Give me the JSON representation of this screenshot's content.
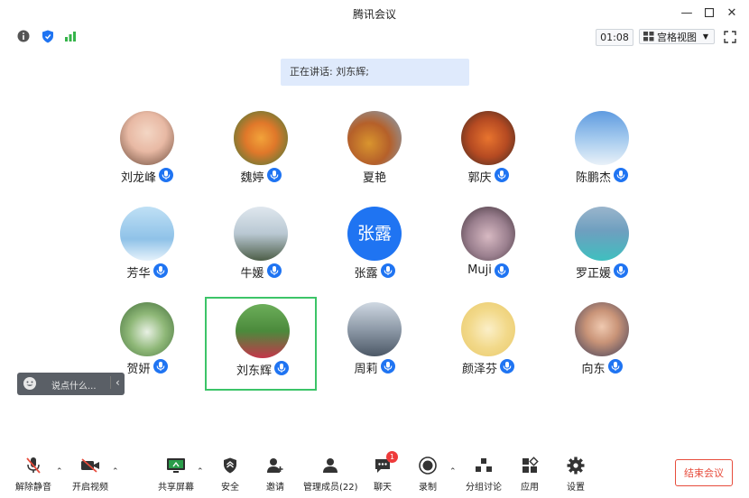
{
  "window": {
    "title": "腾讯会议"
  },
  "infobar": {
    "timer": "01:08",
    "view_mode": "宫格视图"
  },
  "speaking": {
    "text": "正在讲话: 刘东辉;"
  },
  "participants": [
    {
      "name": "刘龙峰",
      "mic": true
    },
    {
      "name": "魏婷",
      "mic": true
    },
    {
      "name": "夏艳",
      "mic": false
    },
    {
      "name": "郭庆",
      "mic": true
    },
    {
      "name": "陈鹏杰",
      "mic": true
    },
    {
      "name": "芳华",
      "mic": true
    },
    {
      "name": "牛媛",
      "mic": true
    },
    {
      "name": "张露",
      "mic": true,
      "avatar_text": "张露"
    },
    {
      "name": "Muji",
      "mic": true
    },
    {
      "name": "罗正媛",
      "mic": true
    },
    {
      "name": "贺妍",
      "mic": true
    },
    {
      "name": "刘东辉",
      "mic": true,
      "active": true
    },
    {
      "name": "周莉",
      "mic": true
    },
    {
      "name": "颜泽芬",
      "mic": true
    },
    {
      "name": "向东",
      "mic": true
    }
  ],
  "chat": {
    "placeholder": "说点什么..."
  },
  "toolbar": {
    "unmute": "解除静音",
    "video": "开启视频",
    "share": "共享屏幕",
    "security": "安全",
    "invite": "邀请",
    "members": "管理成员(22)",
    "chat": "聊天",
    "chat_badge": "1",
    "record": "录制",
    "breakout": "分组讨论",
    "apps": "应用",
    "settings": "设置",
    "end": "结束会议"
  },
  "colors": {
    "accent": "#1f74f2",
    "active_border": "#3cc468",
    "end": "#e74c3c"
  }
}
